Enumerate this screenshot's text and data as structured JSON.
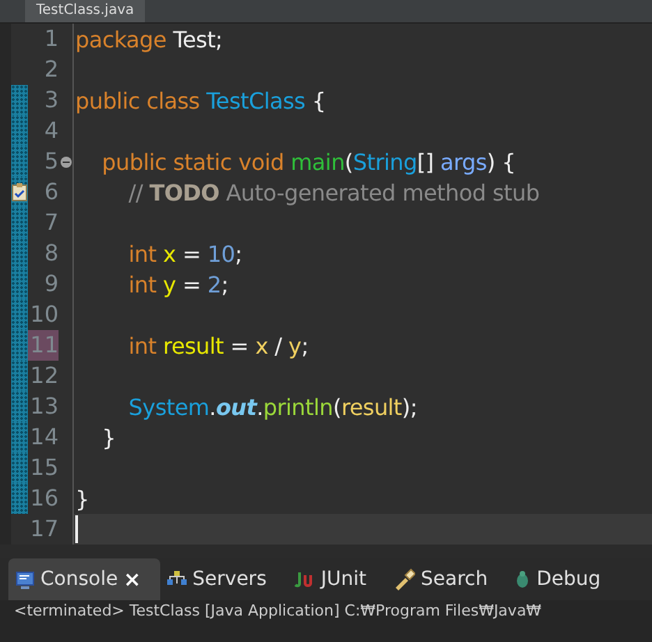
{
  "editor_tab": {
    "title": "TestClass.java"
  },
  "lines": [
    {
      "number": "1",
      "range": false,
      "marked": false,
      "current": false,
      "tokens": [
        {
          "kind": "keyword",
          "text": "package "
        },
        {
          "kind": "plain",
          "text": "Test;"
        }
      ]
    },
    {
      "number": "2",
      "range": false,
      "marked": false,
      "current": false
    },
    {
      "number": "3",
      "range": true,
      "marked": false,
      "current": false,
      "tokens": [
        {
          "kind": "keyword",
          "text": "public class "
        },
        {
          "kind": "type",
          "text": "TestClass"
        },
        {
          "kind": "plain",
          "text": " {"
        }
      ]
    },
    {
      "number": "4",
      "range": true,
      "marked": false,
      "current": false
    },
    {
      "number": "5",
      "range": true,
      "marked": false,
      "current": false,
      "fold": true,
      "tokens": [
        {
          "kind": "keyword",
          "text": "    public static void "
        },
        {
          "kind": "method",
          "text": "main"
        },
        {
          "kind": "plain",
          "text": "("
        },
        {
          "kind": "type",
          "text": "String"
        },
        {
          "kind": "plain",
          "text": "[] "
        },
        {
          "kind": "param",
          "text": "args"
        },
        {
          "kind": "plain",
          "text": ") {"
        }
      ]
    },
    {
      "number": "6",
      "range": true,
      "marked": false,
      "current": false,
      "task": true,
      "tokens": [
        {
          "kind": "comment",
          "text": "        // "
        },
        {
          "kind": "todo",
          "text": "TODO"
        },
        {
          "kind": "comment",
          "text": " Auto-generated method stub"
        }
      ]
    },
    {
      "number": "7",
      "range": true,
      "marked": false,
      "current": false
    },
    {
      "number": "8",
      "range": true,
      "marked": false,
      "current": false,
      "tokens": [
        {
          "kind": "keyword",
          "text": "        int "
        },
        {
          "kind": "var",
          "text": "x"
        },
        {
          "kind": "plain",
          "text": " = "
        },
        {
          "kind": "number",
          "text": "10"
        },
        {
          "kind": "plain",
          "text": ";"
        }
      ]
    },
    {
      "number": "9",
      "range": true,
      "marked": false,
      "current": false,
      "tokens": [
        {
          "kind": "keyword",
          "text": "        int "
        },
        {
          "kind": "var",
          "text": "y"
        },
        {
          "kind": "plain",
          "text": " = "
        },
        {
          "kind": "number",
          "text": "2"
        },
        {
          "kind": "plain",
          "text": ";"
        }
      ]
    },
    {
      "number": "10",
      "range": true,
      "marked": false,
      "current": false
    },
    {
      "number": "11",
      "range": true,
      "marked": true,
      "current": false,
      "tokens": [
        {
          "kind": "keyword",
          "text": "        int "
        },
        {
          "kind": "var",
          "text": "result"
        },
        {
          "kind": "plain",
          "text": " = "
        },
        {
          "kind": "local",
          "text": "x"
        },
        {
          "kind": "plain",
          "text": " / "
        },
        {
          "kind": "local",
          "text": "y"
        },
        {
          "kind": "plain",
          "text": ";"
        }
      ]
    },
    {
      "number": "12",
      "range": true,
      "marked": false,
      "current": false
    },
    {
      "number": "13",
      "range": true,
      "marked": false,
      "current": false,
      "tokens": [
        {
          "kind": "type",
          "text": "        System"
        },
        {
          "kind": "plain",
          "text": "."
        },
        {
          "kind": "field",
          "text": "out"
        },
        {
          "kind": "plain",
          "text": "."
        },
        {
          "kind": "call",
          "text": "println"
        },
        {
          "kind": "plain",
          "text": "("
        },
        {
          "kind": "local",
          "text": "result"
        },
        {
          "kind": "plain",
          "text": ");"
        }
      ]
    },
    {
      "number": "14",
      "range": true,
      "marked": false,
      "current": false,
      "tokens": [
        {
          "kind": "plain",
          "text": "    }"
        }
      ]
    },
    {
      "number": "15",
      "range": true,
      "marked": false,
      "current": false
    },
    {
      "number": "16",
      "range": true,
      "marked": false,
      "current": false,
      "tokens": [
        {
          "kind": "plain",
          "text": "}"
        }
      ]
    },
    {
      "number": "17",
      "range": false,
      "marked": false,
      "current": true
    }
  ],
  "panel_tabs": [
    {
      "kind": "console",
      "label": "Console",
      "selected": true,
      "close": "×"
    },
    {
      "kind": "servers",
      "label": "Servers",
      "selected": false
    },
    {
      "kind": "junit",
      "label": "JUnit",
      "selected": false
    },
    {
      "kind": "search",
      "label": "Search",
      "selected": false
    },
    {
      "kind": "debug",
      "label": "Debug",
      "selected": false
    }
  ],
  "console_status": "<terminated> TestClass [Java Application] C:₩Program Files₩Java₩"
}
